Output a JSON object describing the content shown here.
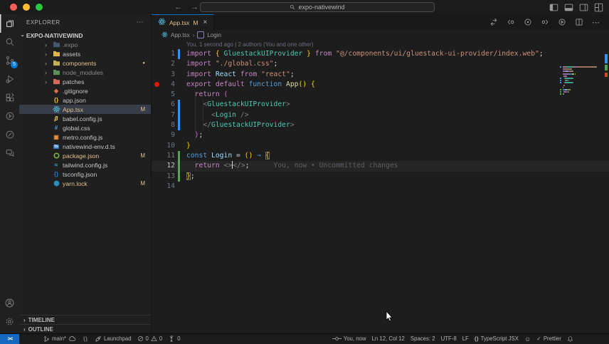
{
  "colors": {
    "accent": "#0078d4",
    "modified": "#e2c08d",
    "gutter_modified": "#3b8eea",
    "gutter_added": "#53a653",
    "breakpoint": "#e51400",
    "remote_bg": "#1468c0",
    "traffic": [
      "#ff5f56",
      "#ffbd2e",
      "#27c93f"
    ]
  },
  "titlebar": {
    "search_value": "expo-nativewind",
    "nav_icons": [
      "arrow-left",
      "arrow-right"
    ],
    "layout_icons": [
      "panel-left",
      "panel-bottom",
      "panel-right",
      "layout-customize"
    ]
  },
  "activity_bar": {
    "items": [
      {
        "name": "explorer",
        "active": true
      },
      {
        "name": "search"
      },
      {
        "name": "source-control",
        "badge": "5"
      },
      {
        "name": "run-debug"
      },
      {
        "name": "extensions"
      },
      {
        "name": "plugin-play"
      },
      {
        "name": "plugin-pencil"
      },
      {
        "name": "chat"
      }
    ],
    "bottom": [
      {
        "name": "accounts"
      },
      {
        "name": "settings"
      }
    ]
  },
  "sidebar": {
    "header": "EXPLORER",
    "header_more": "⋯",
    "root_label": "EXPO-NATIVEWIND",
    "items": [
      {
        "label": ".expo",
        "type": "folder",
        "icon": "folder-expo",
        "dim": true
      },
      {
        "label": "assets",
        "type": "folder",
        "icon": "folder-assets"
      },
      {
        "label": "components",
        "type": "folder",
        "icon": "folder-components",
        "modified": true,
        "badge": "●"
      },
      {
        "label": "node_modules",
        "type": "folder",
        "icon": "folder-node",
        "dim": true
      },
      {
        "label": "patches",
        "type": "folder",
        "icon": "folder-patches"
      },
      {
        "label": ".gitignore",
        "icon": "git"
      },
      {
        "label": "app.json",
        "icon": "json"
      },
      {
        "label": "App.tsx",
        "icon": "react",
        "modified": true,
        "badge": "M",
        "selected": true
      },
      {
        "label": "babel.config.js",
        "icon": "babel"
      },
      {
        "label": "global.css",
        "icon": "css"
      },
      {
        "label": "metro.config.js",
        "icon": "metro"
      },
      {
        "label": "nativewind-env.d.ts",
        "icon": "ts-def"
      },
      {
        "label": "package.json",
        "icon": "npm",
        "modified": true,
        "badge": "M"
      },
      {
        "label": "tailwind.config.js",
        "icon": "tailwind"
      },
      {
        "label": "tsconfig.json",
        "icon": "tsconfig"
      },
      {
        "label": "yarn.lock",
        "icon": "yarn",
        "modified": true,
        "badge": "M"
      }
    ],
    "panels": [
      "TIMELINE",
      "OUTLINE"
    ]
  },
  "editor": {
    "tab": {
      "label": "App.tsx",
      "badge": "M",
      "close_glyph": "×"
    },
    "actions": [
      "open-changes",
      "previous-change",
      "compare-circle",
      "next-change",
      "run",
      "split-editor",
      "more"
    ],
    "breadcrumb": {
      "file": "App.tsx",
      "symbol": "Login"
    },
    "blame_top": "You, 1 second ago | 2 authors (You and one other)",
    "lines": [
      {
        "n": 1,
        "change": "mod",
        "tokens": [
          [
            "kw",
            "import "
          ],
          [
            "b1",
            "{ "
          ],
          [
            "type",
            "GluestackUIProvider"
          ],
          [
            "b1",
            " }"
          ],
          [
            "kw",
            " from "
          ],
          [
            "str",
            "\"@/components/ui/gluestack-ui-provider/index.web\""
          ],
          [
            "pn",
            ";"
          ]
        ]
      },
      {
        "n": 2,
        "tokens": [
          [
            "kw",
            "import "
          ],
          [
            "str",
            "\"./global.css\""
          ],
          [
            "pn",
            ";"
          ]
        ]
      },
      {
        "n": 3,
        "tokens": [
          [
            "kw",
            "import "
          ],
          [
            "var",
            "React"
          ],
          [
            "kw",
            " from "
          ],
          [
            "str",
            "\"react\""
          ],
          [
            "pn",
            ";"
          ]
        ]
      },
      {
        "n": 4,
        "breakpoint": true,
        "tokens": [
          [
            "kw",
            "export default "
          ],
          [
            "kw2",
            "function "
          ],
          [
            "fn",
            "App"
          ],
          [
            "b1",
            "()"
          ],
          [
            "pn",
            " "
          ],
          [
            "b1",
            "{"
          ]
        ]
      },
      {
        "n": 5,
        "tokens": [
          [
            "pn",
            "  "
          ],
          [
            "kw",
            "return "
          ],
          [
            "b2",
            "("
          ]
        ]
      },
      {
        "n": 6,
        "change": "mod",
        "tokens": [
          [
            "pn",
            "    "
          ],
          [
            "ab",
            "<"
          ],
          [
            "type",
            "GluestackUIProvider"
          ],
          [
            "ab",
            ">"
          ]
        ]
      },
      {
        "n": 7,
        "change": "mod",
        "tokens": [
          [
            "pn",
            "      "
          ],
          [
            "ab",
            "<"
          ],
          [
            "type",
            "Login"
          ],
          [
            "pn",
            " "
          ],
          [
            "ab",
            "/>"
          ]
        ]
      },
      {
        "n": 8,
        "change": "mod",
        "tokens": [
          [
            "pn",
            "    "
          ],
          [
            "ab",
            "</"
          ],
          [
            "type",
            "GluestackUIProvider"
          ],
          [
            "ab",
            ">"
          ]
        ]
      },
      {
        "n": 9,
        "tokens": [
          [
            "pn",
            "  "
          ],
          [
            "b2",
            ")"
          ],
          [
            "pn",
            ";"
          ]
        ]
      },
      {
        "n": 10,
        "tokens": [
          [
            "b1",
            "}"
          ]
        ]
      },
      {
        "n": 11,
        "change": "add",
        "tokens": [
          [
            "kw2",
            "const "
          ],
          [
            "var",
            "Login"
          ],
          [
            "pn",
            " = "
          ],
          [
            "b1",
            "()"
          ],
          [
            "op",
            " ⇒ "
          ],
          [
            "b1x",
            "{"
          ]
        ]
      },
      {
        "n": 12,
        "change": "add",
        "current": true,
        "inline_blame": "You, now • Uncommitted changes",
        "tokens": [
          [
            "pn",
            "  "
          ],
          [
            "kw",
            "return "
          ],
          [
            "ab",
            "<>"
          ],
          [
            "caret",
            ""
          ],
          [
            "ab",
            "</>"
          ],
          [
            "pn",
            ";"
          ]
        ]
      },
      {
        "n": 13,
        "change": "add",
        "tokens": [
          [
            "b1x",
            "}"
          ],
          [
            "pn",
            ";"
          ]
        ]
      },
      {
        "n": 14,
        "tokens": []
      }
    ]
  },
  "status_bar": {
    "left": [
      {
        "name": "remote",
        "accent": true,
        "parts": [
          {
            "icon": "remote"
          }
        ]
      },
      {
        "name": "branch",
        "parts": [
          {
            "icon": "branch"
          },
          {
            "text": "main*"
          },
          {
            "icon": "cloud"
          }
        ]
      },
      {
        "name": "compare",
        "parts": [
          {
            "icon": "compare"
          }
        ]
      },
      {
        "name": "launchpad",
        "parts": [
          {
            "icon": "rocket"
          },
          {
            "text": "Launchpad"
          }
        ]
      },
      {
        "name": "problems",
        "parts": [
          {
            "icon": "error"
          },
          {
            "text": "0"
          },
          {
            "icon": "warning"
          },
          {
            "text": "0"
          }
        ]
      },
      {
        "name": "ports",
        "parts": [
          {
            "icon": "tower"
          },
          {
            "text": "0"
          }
        ]
      }
    ],
    "right": [
      {
        "name": "blame",
        "parts": [
          {
            "icon": "commit"
          },
          {
            "text": "You, now"
          }
        ]
      },
      {
        "name": "cursor-position",
        "parts": [
          {
            "text": "Ln 12, Col 12"
          }
        ]
      },
      {
        "name": "indentation",
        "parts": [
          {
            "text": "Spaces: 2"
          }
        ]
      },
      {
        "name": "encoding",
        "parts": [
          {
            "text": "UTF-8"
          }
        ]
      },
      {
        "name": "eol",
        "parts": [
          {
            "text": "LF"
          }
        ]
      },
      {
        "name": "language",
        "parts": [
          {
            "icon": "braces"
          },
          {
            "text": "TypeScript JSX"
          }
        ]
      },
      {
        "name": "feedback",
        "parts": [
          {
            "icon": "smiley"
          }
        ]
      },
      {
        "name": "formatter",
        "parts": [
          {
            "icon": "check"
          },
          {
            "text": "Prettier"
          }
        ]
      },
      {
        "name": "notifications",
        "parts": [
          {
            "icon": "bell"
          }
        ]
      }
    ]
  }
}
